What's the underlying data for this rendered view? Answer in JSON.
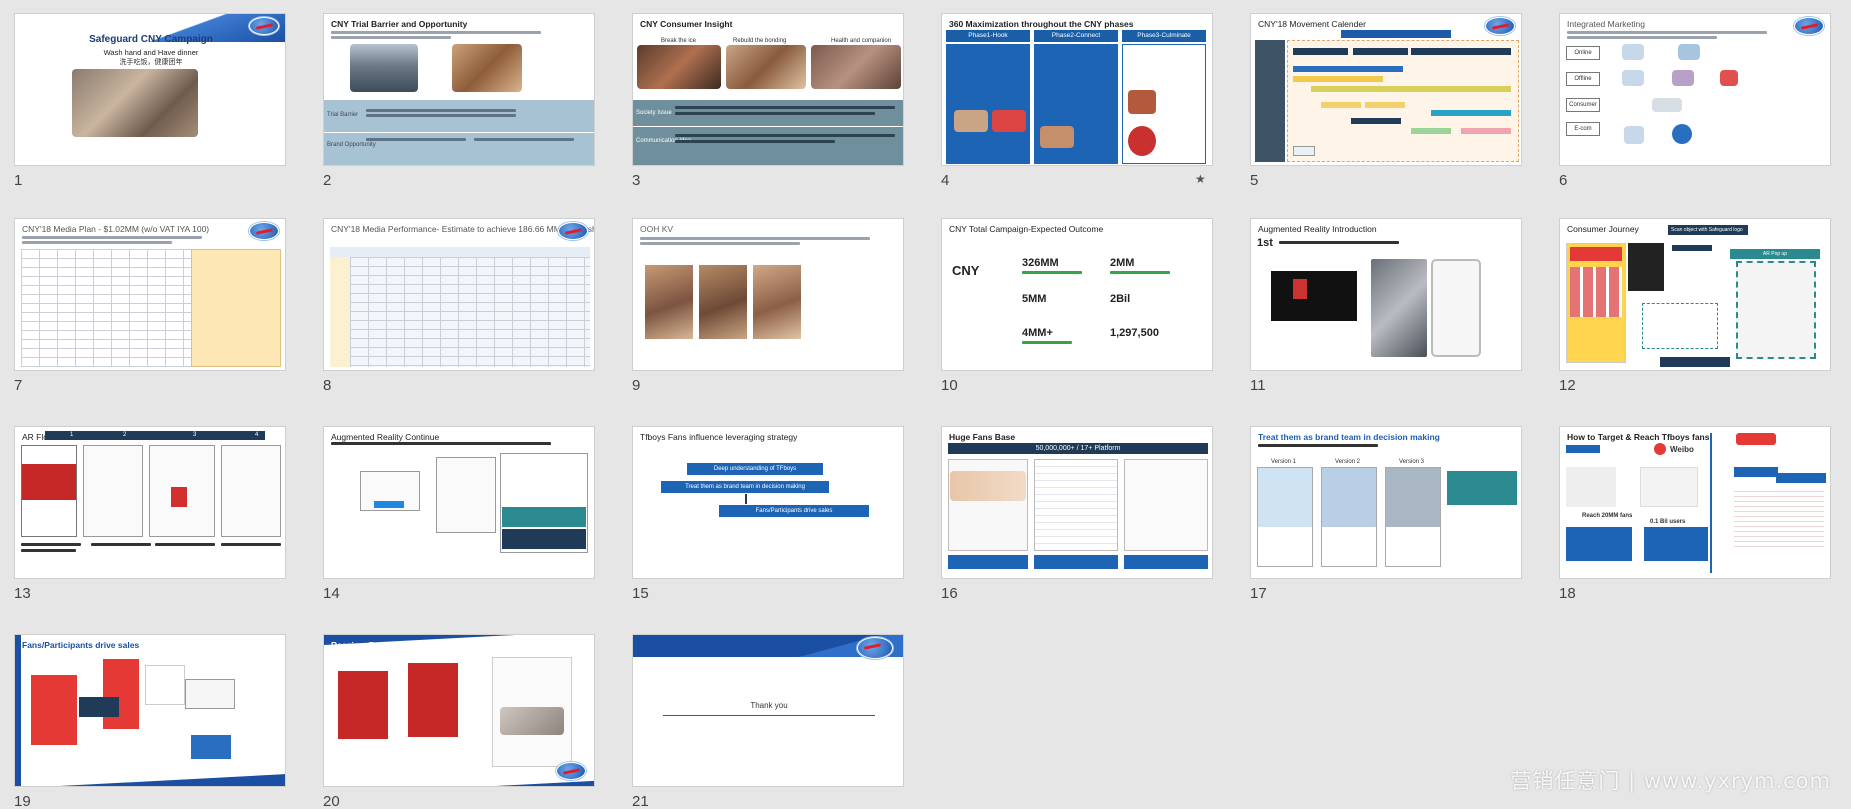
{
  "slides": [
    {
      "n": "1",
      "title": "Safeguard CNY Campaign",
      "subtitle": "Wash hand and Have dinner",
      "subtitle_cn": "洗手吃饭，健康团年"
    },
    {
      "n": "2",
      "title": "CNY Trial Barrier and Opportunity",
      "labels": [
        "Trial Barrier",
        "Brand Opportunity"
      ]
    },
    {
      "n": "3",
      "title": "CNY Consumer Insight",
      "captions": [
        "Break the ice",
        "Rebuild the bonding",
        "Health and companion"
      ],
      "labels": [
        "Society Issue",
        "Communication Idea"
      ]
    },
    {
      "n": "4",
      "title": "360 Maximization throughout the CNY phases",
      "phases": [
        "Phase1-Hook",
        "Phase2-Connect",
        "Phase3-Culminate"
      ]
    },
    {
      "n": "5",
      "title": "CNY'18 Movement Calender"
    },
    {
      "n": "6",
      "title": "Integrated Marketing",
      "rows": [
        "Online",
        "Offline",
        "Consumer",
        "E-com"
      ]
    },
    {
      "n": "7",
      "title": "CNY'18 Media Plan - $1.02MM (w/o VAT IYA 100)"
    },
    {
      "n": "8",
      "title": "CNY'18 Media Performance- Estimate to achieve 186.66 MM viewership"
    },
    {
      "n": "9",
      "title": "OOH KV"
    },
    {
      "n": "10",
      "title": "CNY Total Campaign-Expected Outcome",
      "label": "CNY",
      "stats": [
        "326MM",
        "2MM",
        "5MM",
        "2Bil",
        "4MM+",
        "1,297,500"
      ]
    },
    {
      "n": "11",
      "title": "Augmented Reality Introduction",
      "label": "1st"
    },
    {
      "n": "12",
      "title": "Consumer Journey",
      "callouts": [
        "Scan object with Safeguard logo",
        "AR Pop up"
      ]
    },
    {
      "n": "13",
      "title": "AR Flow",
      "steps": [
        "1",
        "2",
        "3",
        "4"
      ]
    },
    {
      "n": "14",
      "title": "Augmented Reality Continue"
    },
    {
      "n": "15",
      "title": "Tfboys Fans influence leveraging strategy",
      "steps": [
        "Deep understanding of TFboys",
        "Treat them as brand team in decision making",
        "Fans/Participants drive sales"
      ]
    },
    {
      "n": "16",
      "title": "Huge Fans Base",
      "banner": "50,000,000+ / 17+ Platform"
    },
    {
      "n": "17",
      "title": "Treat them as brand team in decision making",
      "versions": [
        "Version 1",
        "Version 2",
        "Version 3"
      ]
    },
    {
      "n": "18",
      "title": "How to Target & Reach Tfboys fans",
      "weibo": "Weibo",
      "reach": "Reach 20MM fans",
      "reach2": "0.1 Bil users"
    },
    {
      "n": "19",
      "title": "Fans/Participants drive sales"
    },
    {
      "n": "20",
      "title": "Receiver Received Greeting Card"
    },
    {
      "n": "21",
      "title": "Thank you"
    }
  ],
  "marked_slide": "4",
  "watermark": "营销任意门 | www.yxrym.com",
  "colors": {
    "brand_blue": "#1e5fb3",
    "brand_red": "#e21b2d",
    "dark_navy": "#1f3b57",
    "teal": "#2a8a8f",
    "background": "#e6e6e6"
  }
}
